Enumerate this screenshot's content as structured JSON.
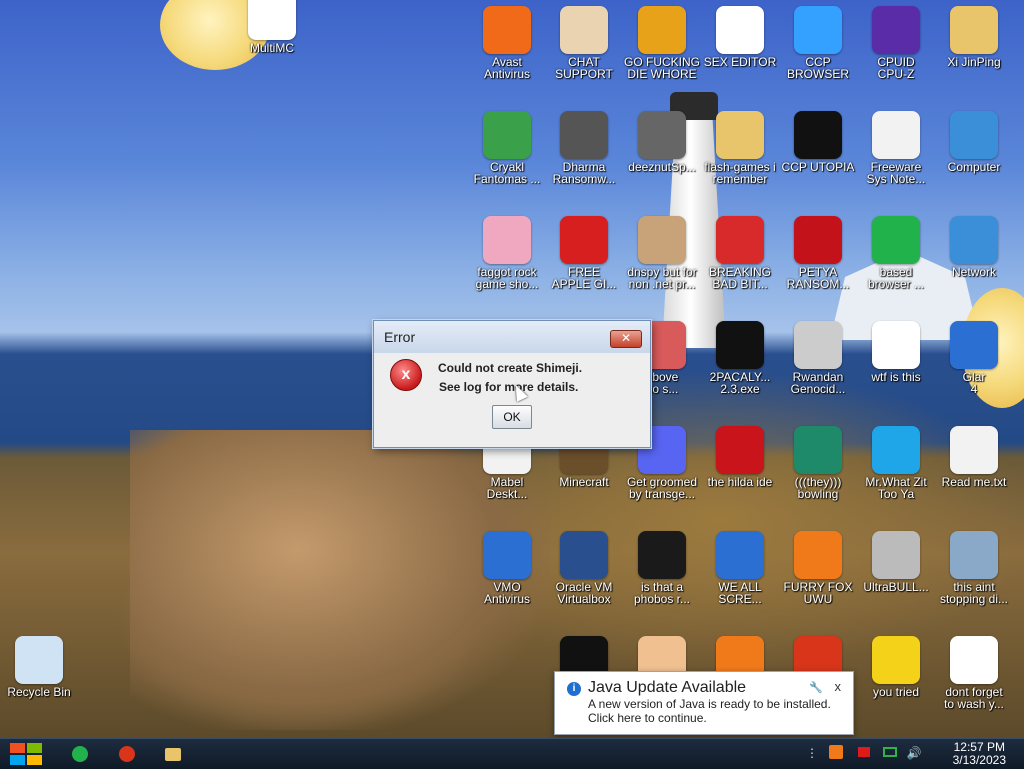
{
  "desktop_icons": [
    {
      "label": "MultiMC",
      "icon": "multimc-icon",
      "color": "#ffffff"
    },
    {
      "label": "Avast\nAntivirus",
      "icon": "avast-icon",
      "color": "#f06a1a"
    },
    {
      "label": "CHAT\nSUPPORT",
      "icon": "doctor-icon",
      "color": "#e9d3b0"
    },
    {
      "label": "GO FUCKING\nDIE WHORE",
      "icon": "die-logo-icon",
      "color": "#e8a21a"
    },
    {
      "label": "SEX EDITOR",
      "icon": "hxd-icon",
      "color": "#ffffff"
    },
    {
      "label": "CCP\nBROWSER",
      "icon": "browser-orb-icon",
      "color": "#34a0ff"
    },
    {
      "label": "CPUID\nCPU-Z",
      "icon": "cpuz-icon",
      "color": "#5b2ca8"
    },
    {
      "label": "Xi JinPing",
      "icon": "folder-user-icon",
      "color": "#e8c46a"
    },
    {
      "label": "Cryakl\nFantomas ...",
      "icon": "window-icon",
      "color": "#3aa04a"
    },
    {
      "label": "Dharma\nRansomw...",
      "icon": "skull-gear-icon",
      "color": "#555555"
    },
    {
      "label": "deeznutSp...",
      "icon": "windows-stack-icon",
      "color": "#666666"
    },
    {
      "label": "flash-games i\nremember",
      "icon": "folder-icon",
      "color": "#e8c46a"
    },
    {
      "label": "CCP UTOPIA",
      "icon": "black-orb-icon",
      "color": "#111111"
    },
    {
      "label": "Freeware\nSys Note...",
      "icon": "document-icon",
      "color": "#f2f2f2"
    },
    {
      "label": "Computer",
      "icon": "computer-icon",
      "color": "#3b8fd8"
    },
    {
      "label": "faggot rock\ngame sho...",
      "icon": "pig-icon",
      "color": "#f0a8c0"
    },
    {
      "label": "FREE\nAPPLE GI...",
      "icon": "apple-icon",
      "color": "#d81f1f"
    },
    {
      "label": "dnspy but for\nnon .net pr...",
      "icon": "portrait-icon",
      "color": "#c8a37a"
    },
    {
      "label": "BREAKING\nBAD BIT...",
      "icon": "angry-bird-icon",
      "color": "#d82a2a"
    },
    {
      "label": "PETYA\nRANSOM...",
      "icon": "skull-red-icon",
      "color": "#c4121a"
    },
    {
      "label": "based\nbrowser ...",
      "icon": "notes-icon",
      "color": "#22b24c"
    },
    {
      "label": "Network",
      "icon": "network-icon",
      "color": "#3b8fd8"
    },
    {
      "label": "above\nno s...",
      "icon": "number-icon",
      "color": "#d85a5a"
    },
    {
      "label": "2PACALY...\n2.3.exe",
      "icon": "cmd-icon",
      "color": "#111111"
    },
    {
      "label": "Rwandan\nGenocid...",
      "icon": "gun-icon",
      "color": "#cccccc"
    },
    {
      "label": "wtf is this",
      "icon": "calendar-doc-icon",
      "color": "#ffffff"
    },
    {
      "label": "Glar\n4",
      "icon": "glar-icon",
      "color": "#2a6fd1"
    },
    {
      "label": "Mabel\nDeskt...",
      "icon": "mabel-doc-icon",
      "color": "#f2f2f2"
    },
    {
      "label": "Minecraft",
      "icon": "minecraft-icon",
      "color": "#6b4f2a"
    },
    {
      "label": "Get groomed\nby transge...",
      "icon": "discord-icon",
      "color": "#5865f2"
    },
    {
      "label": "the hilda ide",
      "icon": "devcpp-icon",
      "color": "#c8141a"
    },
    {
      "label": "(((they)))\nbowling",
      "icon": "santa-ball-icon",
      "color": "#1f8a6a"
    },
    {
      "label": "Mr.What Zit\nToo Ya",
      "icon": "skype-icon",
      "color": "#1fa6e8"
    },
    {
      "label": "Read me.txt",
      "icon": "text-file-icon",
      "color": "#f2f2f2"
    },
    {
      "label": "VMO\nAntivirus",
      "icon": "shield-icon",
      "color": "#2a6fd1"
    },
    {
      "label": "Oracle VM\nVirtualbox",
      "icon": "virtualbox-icon",
      "color": "#2a4f8e"
    },
    {
      "label": "is that a\nphobos r...",
      "icon": "icq-flower-icon",
      "color": "#1a1a1a"
    },
    {
      "label": "WE ALL\nSCRE...",
      "icon": "monitor-icon",
      "color": "#2a6fd1"
    },
    {
      "label": "FURRY FOX\nUWU",
      "icon": "firefox-icon",
      "color": "#f07a1a"
    },
    {
      "label": "UltraBULL...",
      "icon": "disc-icon",
      "color": "#bbbbbb"
    },
    {
      "label": "this aint\nstopping di...",
      "icon": "printer-icon",
      "color": "#8aa8c8"
    },
    {
      "label": "Recycle Bin",
      "icon": "recycle-bin-icon",
      "color": "#cfe3f5"
    },
    {
      "label": "",
      "icon": "skull-black-icon",
      "color": "#111111"
    },
    {
      "label": "",
      "icon": "cartoon-man-icon",
      "color": "#f0c090"
    },
    {
      "label": "",
      "icon": "vlc-icon",
      "color": "#f07a1a"
    },
    {
      "label": "",
      "icon": "chrome-icon",
      "color": "#d8351a"
    },
    {
      "label": "you tried",
      "icon": "star-icon",
      "color": "#f5d21a"
    },
    {
      "label": "dont forget\nto wash y...",
      "icon": "calendar-doc-icon",
      "color": "#ffffff"
    }
  ],
  "error_dialog": {
    "title": "Error",
    "close_label": "✕",
    "line1": "Could not create Shimeji.",
    "line2": "See log for more details.",
    "ok_label": "OK"
  },
  "java_toast": {
    "title": "Java Update Available",
    "line1": "A new version of Java is ready to be installed.",
    "line2": "Click here to continue.",
    "close_label": "x"
  },
  "taskbar": {
    "pinned": [
      {
        "name": "notes-app",
        "icon": "notes-icon",
        "color": "#22b24c"
      },
      {
        "name": "chrome",
        "icon": "chrome-icon",
        "color": "#d8351a"
      },
      {
        "name": "file-explorer",
        "icon": "folder-icon",
        "color": "#e8c46a"
      }
    ],
    "tray_colors": {
      "java": "#f07a1a",
      "flag": "#e01a1a",
      "network": "#2fb24a",
      "volume": "#2fb24a"
    },
    "clock_time": "12:57 PM",
    "clock_date": "3/13/2023"
  }
}
